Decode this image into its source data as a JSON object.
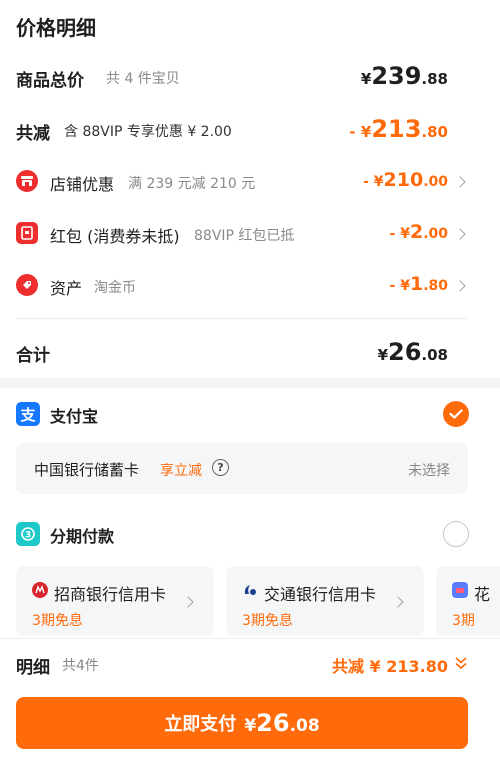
{
  "header": {
    "title": "价格明细"
  },
  "total_goods": {
    "label": "商品总价",
    "sub": "共 4 件宝贝",
    "sym": "¥",
    "int": "239",
    "dec": ".88"
  },
  "discount_total": {
    "label": "共减",
    "sub": "含 88VIP 专享优惠 ¥ 2.00",
    "sym": "- ¥",
    "int": "213",
    "dec": ".80"
  },
  "discounts": [
    {
      "label": "店铺优惠",
      "sub": "满 239 元减 210 元",
      "sym": "- ¥",
      "int": "210",
      "dec": ".00",
      "icon": "store-icon"
    },
    {
      "label": "红包 (消费券未抵)",
      "sub": "88VIP 红包已抵",
      "sym": "- ¥",
      "int": "2",
      "dec": ".00",
      "icon": "red-packet-icon"
    },
    {
      "label": "资产",
      "sub": "淘金币",
      "sym": "- ¥",
      "int": "1",
      "dec": ".80",
      "icon": "asset-tag-icon"
    }
  ],
  "sum": {
    "label": "合计",
    "sym": "¥",
    "int": "26",
    "dec": ".08"
  },
  "alipay": {
    "label": "支付宝",
    "icon": "alipay-icon",
    "selected": true
  },
  "bank_card": {
    "label": "中国银行储蓄卡",
    "promo": "享立减",
    "status": "未选择",
    "icon": "help-icon"
  },
  "installment": {
    "label": "分期付款",
    "icon": "installment-icon",
    "selected": false
  },
  "installment_cards": [
    {
      "name": "招商银行信用卡",
      "promo": "3期免息",
      "icon": "cmb-bank-icon"
    },
    {
      "name": "交通银行信用卡",
      "promo": "3期免息",
      "icon": "bocom-bank-icon"
    },
    {
      "name": "花",
      "promo": "3期",
      "icon": "huabei-icon"
    }
  ],
  "footer": {
    "detail_label": "明细",
    "detail_count": "共4件",
    "saving_text": "共减 ¥ 213.80",
    "pay_label": "立即支付",
    "pay_sym": "¥",
    "pay_int": "26",
    "pay_dec": ".08"
  },
  "colors": {
    "accent": "#ff6a0b",
    "alipay_blue": "#1677ff",
    "red": "#ee2e2e"
  }
}
